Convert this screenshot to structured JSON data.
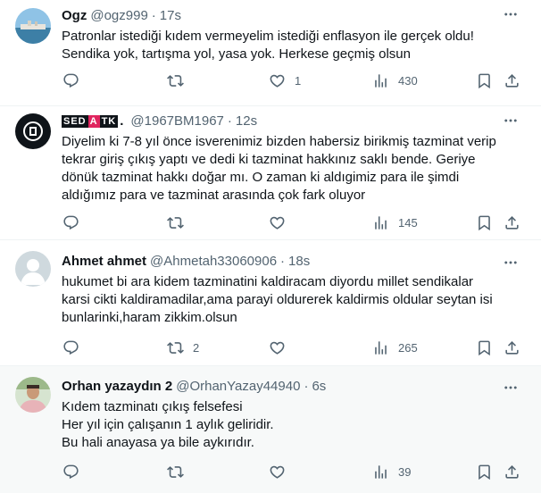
{
  "tweets": [
    {
      "name": "Ogz",
      "handle": "@ogz999",
      "sep": "·",
      "time": "17s",
      "lines": [
        "Patronlar istediği kıdem vermeyelim istediği enflasyon ile gerçek oldu!",
        "Sendika yok, tartışma yol, yasa yok. Herkese geçmiş olsun"
      ],
      "likes": "1",
      "retweets": "",
      "replies": "",
      "views": "430"
    },
    {
      "name_parts": [
        "SED",
        "A",
        "TK",
        "."
      ],
      "handle": "@1967BM1967",
      "sep": "·",
      "time": "12s",
      "lines": [
        "Diyelim ki 7-8 yıl önce isverenimiz bizden habersiz birikmiş tazminat verip",
        "tekrar giriş çıkış yaptı ve dedi ki tazminat hakkınız saklı bende. Geriye",
        "dönük tazminat hakkı doğar mı. O zaman ki aldıgimiz para ile şimdi",
        "aldığımız para ve tazminat arasında çok fark oluyor"
      ],
      "likes": "",
      "retweets": "",
      "replies": "",
      "views": "145"
    },
    {
      "name": "Ahmet ahmet",
      "handle": "@Ahmetah33060906",
      "sep": "·",
      "time": "18s",
      "lines": [
        "hukumet bi ara kidem tazminatini kaldiracam diyordu millet sendikalar",
        "karsi cikti kaldiramadilar,ama parayi oldurerek kaldirmis oldular seytan isi",
        "bunlarinki,haram zikkim.olsun"
      ],
      "likes": "",
      "retweets": "2",
      "replies": "",
      "views": "265"
    },
    {
      "name": "Orhan yazaydın 2",
      "handle": "@OrhanYazay44940",
      "sep": "·",
      "time": "6s",
      "lines": [
        "Kıdem tazminatı çıkış felsefesi",
        "Her yıl için çalışanın 1 aylık geliridir.",
        "Bu hali anayasa ya bile aykırıdır."
      ],
      "likes": "",
      "retweets": "",
      "replies": "",
      "views": "39"
    }
  ],
  "colors": {
    "text": "#0f1419",
    "muted": "#536471",
    "border": "#eff3f4",
    "highlight_bg": "#f7f9f9",
    "sedatk_red": "#e0245e"
  },
  "icons": [
    "reply-icon",
    "retweet-icon",
    "like-icon",
    "views-icon",
    "bookmark-icon",
    "share-icon",
    "more-icon"
  ]
}
